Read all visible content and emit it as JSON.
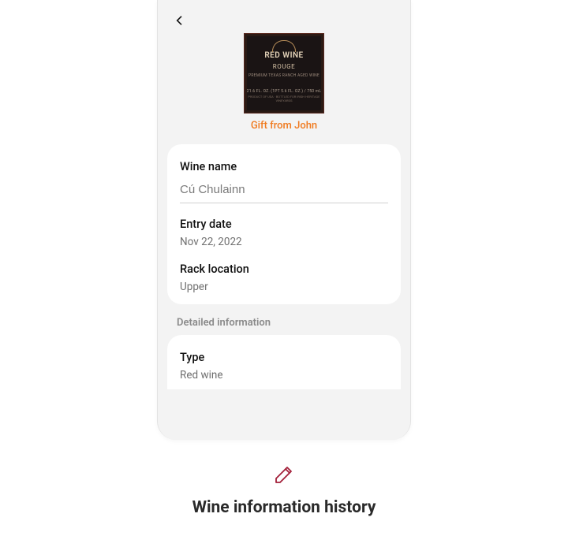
{
  "header": {
    "label_line1": "RED WINE",
    "label_line2": "ROUGE",
    "label_line3": "PREMIUM TEXAS RANCH AGED WINE",
    "label_line4": "21.6 FL. OZ. (1PT 5.6 FL. OZ.) / 750 mL",
    "label_line5": "PRODUCT OF USA · BOTTLED FOR IRISH HERITAGE VINEYARDS",
    "caption": "Gift from John"
  },
  "fields": {
    "wine_name_label": "Wine name",
    "wine_name_value": "Cú Chulainn",
    "entry_date_label": "Entry date",
    "entry_date_value": "Nov 22, 2022",
    "rack_location_label": "Rack location",
    "rack_location_value": "Upper"
  },
  "section": {
    "detailed_info": "Detailed information",
    "type_label": "Type",
    "type_value": "Red wine"
  },
  "footer": {
    "title": "Wine information history"
  }
}
